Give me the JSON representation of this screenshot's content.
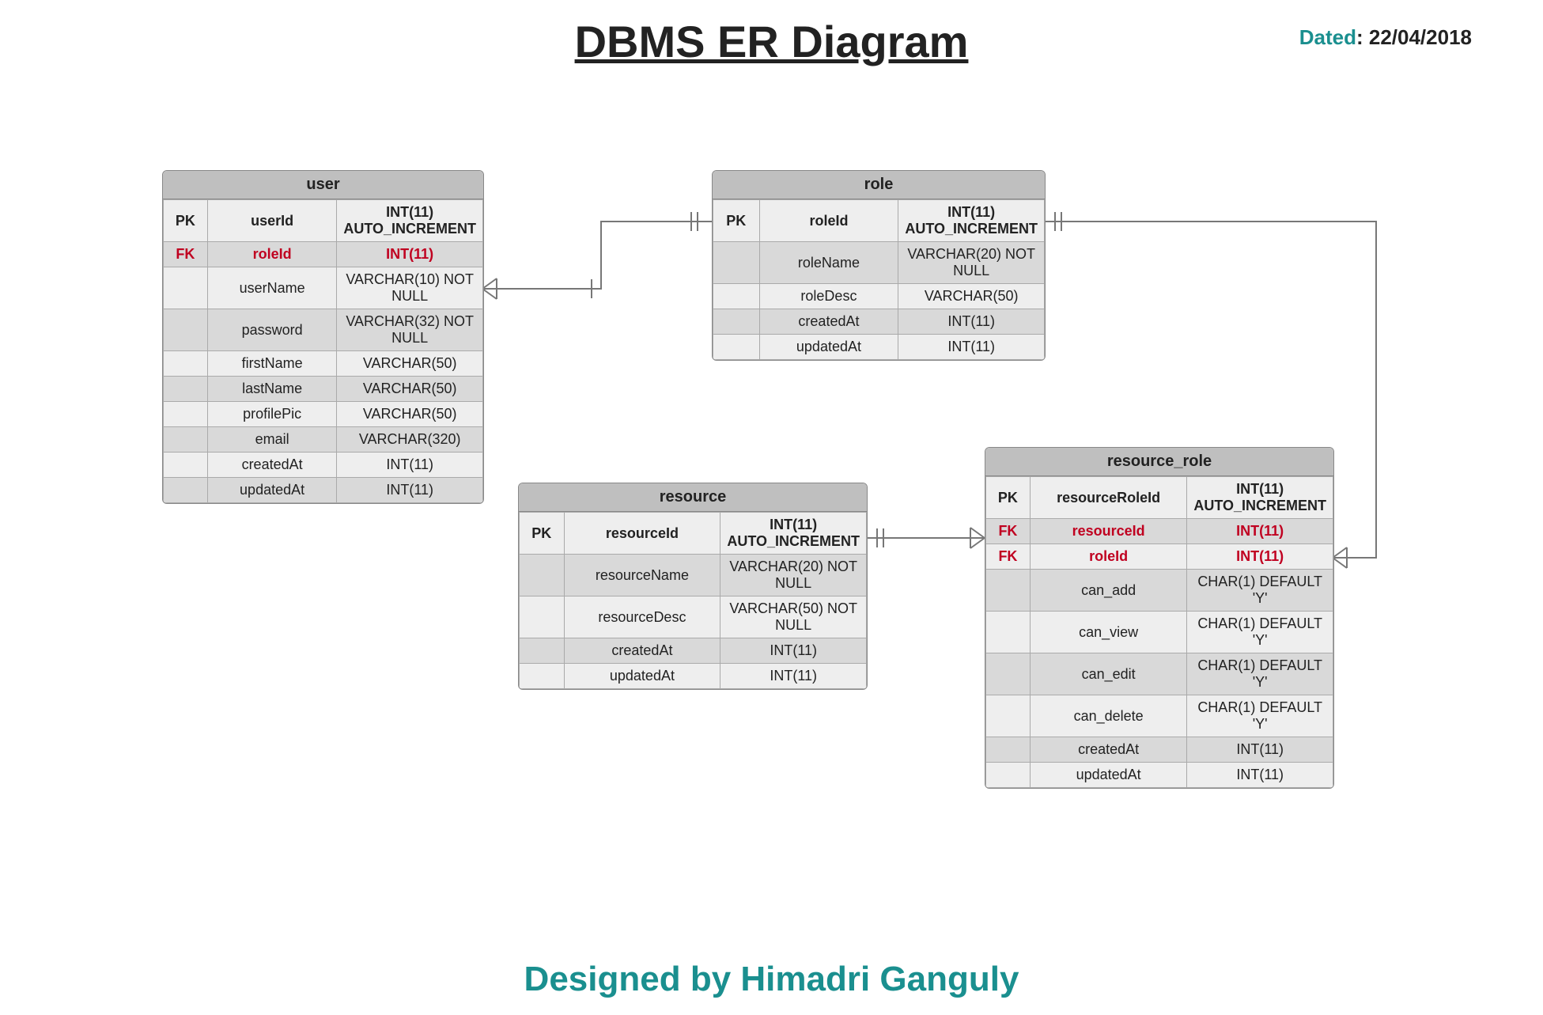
{
  "title": "DBMS ER Diagram",
  "dated_label": "Dated",
  "dated_value": ": 22/04/2018",
  "footer": "Designed by Himadri Ganguly",
  "entities": {
    "user": {
      "name": "user",
      "rows": [
        {
          "key": "PK",
          "name": "userId",
          "type": "INT(11) AUTO_INCREMENT",
          "kind": "pk"
        },
        {
          "key": "FK",
          "name": "roleId",
          "type": "INT(11)",
          "kind": "fk"
        },
        {
          "key": "",
          "name": "userName",
          "type": "VARCHAR(10) NOT NULL",
          "kind": "plain"
        },
        {
          "key": "",
          "name": "password",
          "type": "VARCHAR(32) NOT NULL",
          "kind": "plain"
        },
        {
          "key": "",
          "name": "firstName",
          "type": "VARCHAR(50)",
          "kind": "plain"
        },
        {
          "key": "",
          "name": "lastName",
          "type": "VARCHAR(50)",
          "kind": "plain"
        },
        {
          "key": "",
          "name": "profilePic",
          "type": "VARCHAR(50)",
          "kind": "plain"
        },
        {
          "key": "",
          "name": "email",
          "type": "VARCHAR(320)",
          "kind": "plain"
        },
        {
          "key": "",
          "name": "createdAt",
          "type": "INT(11)",
          "kind": "plain"
        },
        {
          "key": "",
          "name": "updatedAt",
          "type": "INT(11)",
          "kind": "plain"
        }
      ]
    },
    "role": {
      "name": "role",
      "rows": [
        {
          "key": "PK",
          "name": "roleId",
          "type": "INT(11) AUTO_INCREMENT",
          "kind": "pk"
        },
        {
          "key": "",
          "name": "roleName",
          "type": "VARCHAR(20) NOT NULL",
          "kind": "plain"
        },
        {
          "key": "",
          "name": "roleDesc",
          "type": "VARCHAR(50)",
          "kind": "plain"
        },
        {
          "key": "",
          "name": "createdAt",
          "type": "INT(11)",
          "kind": "plain"
        },
        {
          "key": "",
          "name": "updatedAt",
          "type": "INT(11)",
          "kind": "plain"
        }
      ]
    },
    "resource": {
      "name": "resource",
      "rows": [
        {
          "key": "PK",
          "name": "resourceId",
          "type": "INT(11) AUTO_INCREMENT",
          "kind": "pk"
        },
        {
          "key": "",
          "name": "resourceName",
          "type": "VARCHAR(20) NOT NULL",
          "kind": "plain"
        },
        {
          "key": "",
          "name": "resourceDesc",
          "type": "VARCHAR(50) NOT NULL",
          "kind": "plain"
        },
        {
          "key": "",
          "name": "createdAt",
          "type": "INT(11)",
          "kind": "plain"
        },
        {
          "key": "",
          "name": "updatedAt",
          "type": "INT(11)",
          "kind": "plain"
        }
      ]
    },
    "resource_role": {
      "name": "resource_role",
      "rows": [
        {
          "key": "PK",
          "name": "resourceRoleId",
          "type": "INT(11) AUTO_INCREMENT",
          "kind": "pk"
        },
        {
          "key": "FK",
          "name": "resourceId",
          "type": "INT(11)",
          "kind": "fk"
        },
        {
          "key": "FK",
          "name": "roleId",
          "type": "INT(11)",
          "kind": "fk"
        },
        {
          "key": "",
          "name": "can_add",
          "type": "CHAR(1) DEFAULT 'Y'",
          "kind": "plain"
        },
        {
          "key": "",
          "name": "can_view",
          "type": "CHAR(1) DEFAULT 'Y'",
          "kind": "plain"
        },
        {
          "key": "",
          "name": "can_edit",
          "type": "CHAR(1) DEFAULT 'Y'",
          "kind": "plain"
        },
        {
          "key": "",
          "name": "can_delete",
          "type": "CHAR(1) DEFAULT 'Y'",
          "kind": "plain"
        },
        {
          "key": "",
          "name": "createdAt",
          "type": "INT(11)",
          "kind": "plain"
        },
        {
          "key": "",
          "name": "updatedAt",
          "type": "INT(11)",
          "kind": "plain"
        }
      ]
    }
  },
  "relationships": [
    {
      "from": "user.roleId",
      "to": "role.roleId",
      "type": "many-to-one"
    },
    {
      "from": "resource_role.roleId",
      "to": "role.roleId",
      "type": "many-to-one"
    },
    {
      "from": "resource_role.resourceId",
      "to": "resource.resourceId",
      "type": "many-to-one"
    }
  ]
}
